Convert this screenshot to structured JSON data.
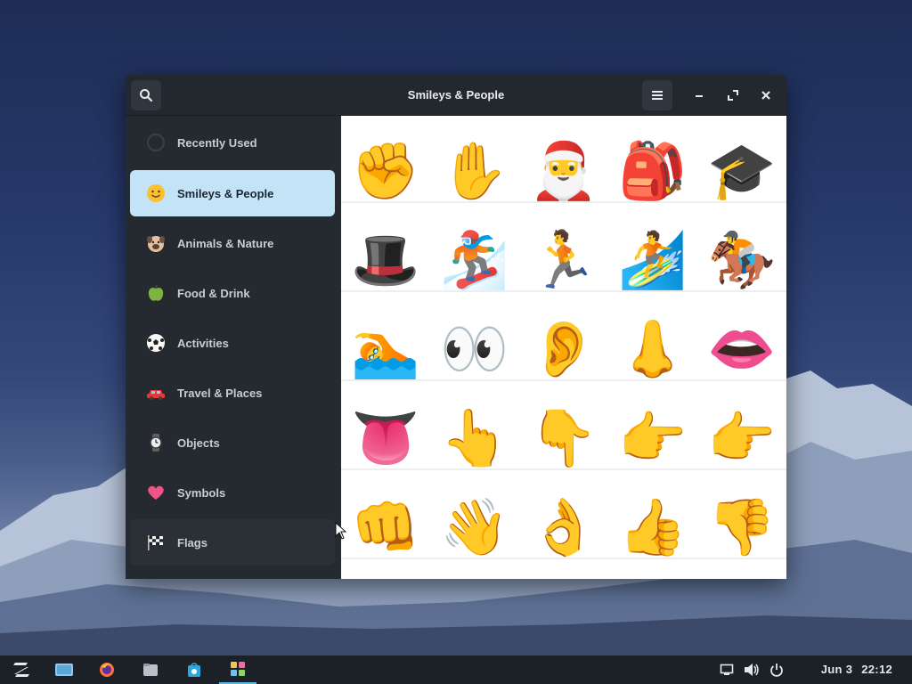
{
  "window": {
    "title": "Smileys & People",
    "search_icon": "search-icon",
    "menu_icon": "hamburger-menu-icon"
  },
  "sidebar": {
    "items": [
      {
        "label": "Recently Used",
        "icon": "clock-icon"
      },
      {
        "label": "Smileys & People",
        "icon": "smiley-icon"
      },
      {
        "label": "Animals & Nature",
        "icon": "dog-face-icon"
      },
      {
        "label": "Food & Drink",
        "icon": "green-apple-icon"
      },
      {
        "label": "Activities",
        "icon": "soccer-ball-icon"
      },
      {
        "label": "Travel & Places",
        "icon": "car-icon"
      },
      {
        "label": "Objects",
        "icon": "watch-icon"
      },
      {
        "label": "Symbols",
        "icon": "heart-icon"
      },
      {
        "label": "Flags",
        "icon": "checkered-flag-icon"
      }
    ],
    "active_index": 1
  },
  "emoji_grid": {
    "rows": [
      [
        "✊",
        "✋",
        "🎅",
        "🎒",
        "🎓"
      ],
      [
        "🎩",
        "🏂",
        "🏃",
        "🏄",
        "🏇"
      ],
      [
        "🏊",
        "👀",
        "👂",
        "👃",
        "👄"
      ],
      [
        "👅",
        "👆",
        "👇",
        "👉",
        "👉"
      ],
      [
        "👊",
        "👋",
        "👌",
        "👍",
        "👎"
      ]
    ]
  },
  "taskbar": {
    "apps": [
      "zorin-menu-icon",
      "workspaces-icon",
      "firefox-icon",
      "files-icon",
      "software-store-icon",
      "emoji-picker-icon"
    ],
    "tray": [
      "display-icon",
      "volume-icon",
      "power-icon"
    ],
    "date": "Jun 3",
    "time": "22:12"
  },
  "colors": {
    "accent": "#c3e3f7",
    "window_bg": "#252a30",
    "taskbar_bg": "#1c2127"
  }
}
